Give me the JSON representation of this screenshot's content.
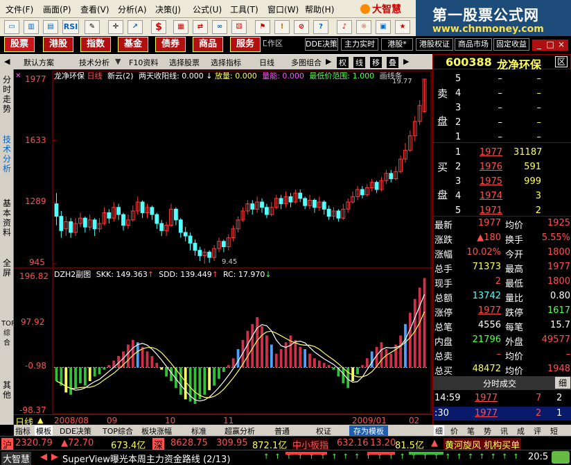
{
  "menu": [
    "文件(F)",
    "画面(P)",
    "查看(V)",
    "分析(A)",
    "决策(J)",
    "公式(U)",
    "工具(T)",
    "窗口(W)",
    "帮助(H)"
  ],
  "logo": "大智慧",
  "brand": {
    "line1": "第一股票公式网",
    "line2": "www.chnmoney.com"
  },
  "toolbar": [
    "RSI",
    "$",
    "?",
    "!"
  ],
  "nav_main": [
    "股票",
    "港股",
    "指数",
    "基金",
    "债券",
    "商品",
    "服务"
  ],
  "nav_small": [
    "工作区",
    "DDE决策",
    "主力实时",
    "港股*",
    "港股权证",
    "商品市场",
    "固定收益"
  ],
  "window_controls": [
    "_",
    "□",
    "×"
  ],
  "tabs": [
    "默认方案",
    "技术分析",
    "F10资料",
    "选择股票",
    "选择指标",
    "日线",
    "多图组合",
    "权",
    "线",
    "移",
    "叠"
  ],
  "stock": {
    "code": "600388",
    "name": "龙净环保",
    "close_btn": "区"
  },
  "left_tabs": [
    "分时走势",
    "技术分析",
    "基本资料",
    "全屏",
    "TOP综合",
    "其他"
  ],
  "main_header": {
    "name": "龙净环保",
    "period": "日线",
    "p1": "新云(2)",
    "p2": "两天收阳线: 0.000",
    "p3": "放量: 0.000",
    "p4": "量能: 0.000",
    "p5": "最低价范围: 1.000",
    "p6": "画线条"
  },
  "main_axis": [
    "1977",
    "1633",
    "1289",
    "945"
  ],
  "annotations": {
    "high": "19.77",
    "low": "9.45"
  },
  "sub_header": {
    "name": "DZH2副图",
    "skk": "SKK: 149.363",
    "sdd": "SDD: 139.449",
    "rc": "RC: 17.970"
  },
  "sub_axis": [
    "196.82",
    "97.92",
    "-0.98",
    "-98.37"
  ],
  "dates": [
    "2008/08",
    "09",
    "10",
    "11",
    "2009/01",
    "02"
  ],
  "period_label": "日线",
  "orderbook": {
    "sell": [
      {
        "l": "5",
        "p": "–",
        "v": "–"
      },
      {
        "l": "4",
        "p": "–",
        "v": "–"
      },
      {
        "l": "3",
        "p": "–",
        "v": "–"
      },
      {
        "l": "2",
        "p": "–",
        "v": "–"
      },
      {
        "l": "1",
        "p": "–",
        "v": "–"
      }
    ],
    "buy": [
      {
        "l": "1",
        "p": "1977",
        "v": "31187"
      },
      {
        "l": "2",
        "p": "1976",
        "v": "591"
      },
      {
        "l": "3",
        "p": "1975",
        "v": "999"
      },
      {
        "l": "4",
        "p": "1974",
        "v": "3"
      },
      {
        "l": "5",
        "p": "1971",
        "v": "2"
      }
    ],
    "sell_label": [
      "卖",
      "盘"
    ],
    "buy_label": [
      "买",
      "盘"
    ]
  },
  "quote": [
    {
      "k1": "最新",
      "v1": "1977",
      "k2": "均价",
      "v2": "1925"
    },
    {
      "k1": "涨跌",
      "v1": "▲180",
      "k2": "换手",
      "v2": "5.55%"
    },
    {
      "k1": "涨幅",
      "v1": "10.02%",
      "k2": "今开",
      "v2": "1800"
    },
    {
      "k1": "总手",
      "v1": "71373",
      "k2": "最高",
      "v2": "1977"
    },
    {
      "k1": "现手",
      "v1": "2",
      "k2": "最低",
      "v2": "1800"
    },
    {
      "k1": "总额",
      "v1": "13742",
      "k2": "量比",
      "v2": "0.80"
    },
    {
      "k1": "涨停",
      "v1": "1977",
      "k2": "跌停",
      "v2": "1617"
    },
    {
      "k1": "总笔",
      "v1": "4556",
      "k2": "每笔",
      "v2": "15.7"
    },
    {
      "k1": "内盘",
      "v1": "21796",
      "k2": "外盘",
      "v2": "49577"
    },
    {
      "k1": "总卖",
      "v1": "–",
      "k2": "均价",
      "v2": "–"
    },
    {
      "k1": "总买",
      "v1": "48472",
      "k2": "均价",
      "v2": "1948"
    }
  ],
  "ticks_title": "分时成交",
  "ticks_btn": "细",
  "ticks": [
    {
      "t": "14:59",
      "p": "1977",
      "v": "7",
      "n": "2"
    },
    {
      "t": ":30",
      "p": "1977",
      "v": "2",
      "n": "1"
    }
  ],
  "bottom_tabs": [
    "指标",
    "模板",
    "DDE决策",
    "TOP综合",
    "板块涨幅",
    "标准",
    "超赢分析",
    "普通",
    "权证",
    "存为模板"
  ],
  "right_tabs": [
    "细",
    "价",
    "笔",
    "势",
    "讯",
    "成",
    "评",
    "短"
  ],
  "status1": {
    "sh": "沪",
    "sh_idx": "2320.79",
    "sh_chg": "▲72.70",
    "sh_amt": "673.4亿",
    "sz": "深",
    "sz_idx": "8628.75",
    "sz_chg": "309.95",
    "sz_amt": "872.1亿",
    "zx": "中小板指",
    "zx_idx": "632.16",
    "zx_chg": "13.20",
    "zx_amt": "81.5亿",
    "news": "黄河旋风 机构买单"
  },
  "status2": {
    "app": "大智慧",
    "ticker": "SuperView曝光本周主力资金路线 (2/13)",
    "time": "20:5"
  },
  "colors": {
    "up": "#ff3c3c",
    "down": "#54ffff",
    "bar_red": "#d0304a",
    "bar_green": "#35c03a",
    "bar_blue": "#4fa0ff",
    "line_yellow": "#ffff66",
    "line_white": "#ffffff"
  },
  "chart_data": {
    "type": "candlestick",
    "price_range": [
      9.45,
      19.77
    ],
    "sub_range": [
      -98.37,
      196.82
    ],
    "candles": [
      [
        12.8,
        12.1,
        13.4,
        11.6
      ],
      [
        12.1,
        11.3,
        12.4,
        10.9
      ],
      [
        11.4,
        11.8,
        12.1,
        11.0
      ],
      [
        11.8,
        11.2,
        12.0,
        10.9
      ],
      [
        11.2,
        11.7,
        12.0,
        11.0
      ],
      [
        11.7,
        12.0,
        12.3,
        11.5
      ],
      [
        12.0,
        11.5,
        12.1,
        11.2
      ],
      [
        11.5,
        11.9,
        12.2,
        11.3
      ],
      [
        11.9,
        11.4,
        12.0,
        11.0
      ],
      [
        11.4,
        11.7,
        12.0,
        11.2
      ],
      [
        11.7,
        12.3,
        12.6,
        11.6
      ],
      [
        12.3,
        12.0,
        12.5,
        11.7
      ],
      [
        12.0,
        12.6,
        12.9,
        11.8
      ],
      [
        12.6,
        12.2,
        12.8,
        11.9
      ],
      [
        12.2,
        11.6,
        12.3,
        11.3
      ],
      [
        11.6,
        11.9,
        12.2,
        11.4
      ],
      [
        11.9,
        12.4,
        12.7,
        11.8
      ],
      [
        12.4,
        12.9,
        13.2,
        12.2
      ],
      [
        12.9,
        12.3,
        13.0,
        12.0
      ],
      [
        12.3,
        12.6,
        12.8,
        12.0
      ],
      [
        12.6,
        12.2,
        12.7,
        11.9
      ],
      [
        12.2,
        11.7,
        12.3,
        11.4
      ],
      [
        11.7,
        11.3,
        11.9,
        11.0
      ],
      [
        11.3,
        11.6,
        11.8,
        11.0
      ],
      [
        11.6,
        12.5,
        12.8,
        11.5
      ],
      [
        12.5,
        11.9,
        12.6,
        11.6
      ],
      [
        11.9,
        11.2,
        12.0,
        10.9
      ],
      [
        11.2,
        11.0,
        11.5,
        10.7
      ],
      [
        11.0,
        10.6,
        11.2,
        10.2
      ],
      [
        10.6,
        10.2,
        10.8,
        9.9
      ],
      [
        10.2,
        9.9,
        10.4,
        9.6
      ],
      [
        9.9,
        10.1,
        10.3,
        9.45
      ],
      [
        10.1,
        9.8,
        10.2,
        9.5
      ],
      [
        9.8,
        10.3,
        10.5,
        9.6
      ],
      [
        10.3,
        10.7,
        10.9,
        10.1
      ],
      [
        10.7,
        10.4,
        10.8,
        10.1
      ],
      [
        10.4,
        10.9,
        11.1,
        10.2
      ],
      [
        10.9,
        11.4,
        11.6,
        10.7
      ],
      [
        11.4,
        11.9,
        12.1,
        11.2
      ],
      [
        11.9,
        12.4,
        12.6,
        11.8
      ],
      [
        12.4,
        12.8,
        13.0,
        12.2
      ],
      [
        12.8,
        12.5,
        13.0,
        12.2
      ],
      [
        12.5,
        12.9,
        13.2,
        12.3
      ],
      [
        12.9,
        12.6,
        13.1,
        12.3
      ],
      [
        12.6,
        12.2,
        12.8,
        12.0
      ],
      [
        12.2,
        12.6,
        12.9,
        12.1
      ],
      [
        12.6,
        13.1,
        13.3,
        12.5
      ],
      [
        13.1,
        12.8,
        13.3,
        12.5
      ],
      [
        12.8,
        13.2,
        13.5,
        12.6
      ],
      [
        13.2,
        12.9,
        13.4,
        12.6
      ],
      [
        12.9,
        13.4,
        13.6,
        12.8
      ],
      [
        13.4,
        13.1,
        13.6,
        12.9
      ],
      [
        13.1,
        12.7,
        13.2,
        12.5
      ],
      [
        12.7,
        13.0,
        13.3,
        12.5
      ],
      [
        13.0,
        12.6,
        13.1,
        12.3
      ],
      [
        12.6,
        12.9,
        13.2,
        12.4
      ],
      [
        12.9,
        12.5,
        13.0,
        12.2
      ],
      [
        12.5,
        12.1,
        12.7,
        11.9
      ],
      [
        12.1,
        12.4,
        12.6,
        11.9
      ],
      [
        12.4,
        12.0,
        12.5,
        11.8
      ],
      [
        12.0,
        12.5,
        12.8,
        11.9
      ],
      [
        12.5,
        12.9,
        13.1,
        12.3
      ],
      [
        12.9,
        13.2,
        13.5,
        12.8
      ],
      [
        13.2,
        13.6,
        13.8,
        13.0
      ],
      [
        13.6,
        13.3,
        13.8,
        13.1
      ],
      [
        13.3,
        13.7,
        13.9,
        13.2
      ],
      [
        13.7,
        14.0,
        14.2,
        13.5
      ],
      [
        14.0,
        13.6,
        14.1,
        13.4
      ],
      [
        13.6,
        14.1,
        14.3,
        13.5
      ],
      [
        14.1,
        14.5,
        14.7,
        13.9
      ],
      [
        14.5,
        14.2,
        14.7,
        14.0
      ],
      [
        14.2,
        14.6,
        14.9,
        14.1
      ],
      [
        14.6,
        15.3,
        15.5,
        14.5
      ],
      [
        15.3,
        15.8,
        16.2,
        15.1
      ],
      [
        15.8,
        16.6,
        16.9,
        15.7
      ],
      [
        16.6,
        17.4,
        17.7,
        16.3
      ],
      [
        17.4,
        18.3,
        18.6,
        17.2
      ],
      [
        17.97,
        19.77,
        19.77,
        17.9
      ]
    ],
    "sub_hist": [
      -30,
      -40,
      -55,
      -60,
      -45,
      -35,
      -40,
      -30,
      -20,
      -15,
      -5,
      5,
      15,
      25,
      35,
      50,
      60,
      55,
      45,
      35,
      25,
      10,
      -5,
      -20,
      -30,
      -45,
      -60,
      -70,
      -75,
      -80,
      -70,
      -60,
      -50,
      -40,
      -25,
      -10,
      5,
      20,
      40,
      60,
      80,
      95,
      110,
      90,
      70,
      50,
      30,
      40,
      55,
      70,
      60,
      45,
      40,
      30,
      20,
      15,
      10,
      5,
      -5,
      -20,
      -35,
      -45,
      -30,
      -15,
      5,
      20,
      35,
      45,
      55,
      40,
      30,
      50,
      70,
      95,
      120,
      150,
      175,
      196
    ]
  }
}
